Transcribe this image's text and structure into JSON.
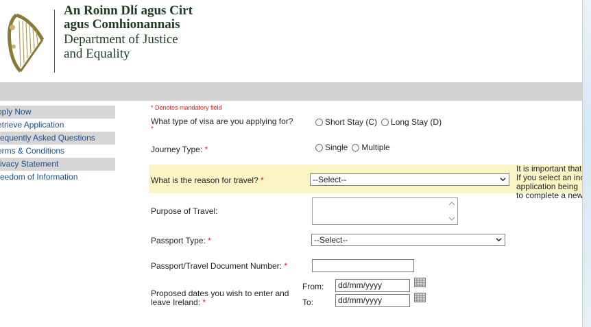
{
  "header": {
    "dept_irish_line1": "An Roinn Dlí agus Cirt",
    "dept_irish_line2": "agus Comhionannais",
    "dept_english_line1": "Department of Justice",
    "dept_english_line2": "and Equality"
  },
  "sidebar": {
    "items": [
      {
        "label": "pply Now"
      },
      {
        "label": "etrieve Application"
      },
      {
        "label": "requently Asked Questions"
      },
      {
        "label": "erms & Conditions"
      },
      {
        "label": "rivacy Statement"
      },
      {
        "label": "reedom of Information"
      }
    ]
  },
  "form": {
    "mandatory_note": "* Denotes mandatory field",
    "visa_type": {
      "label": "What type of visa are you applying for?",
      "options": [
        "Short Stay (C)",
        "Long Stay (D)"
      ]
    },
    "journey_type": {
      "label": "Journey Type:",
      "options": [
        "Single",
        "Multiple"
      ]
    },
    "reason": {
      "label": "What is the reason for travel?",
      "value": "--Select--"
    },
    "purpose": {
      "label": "Purpose of Travel:"
    },
    "passport_type": {
      "label": "Passport Type:",
      "value": "--Select--"
    },
    "passport_number": {
      "label": "Passport/Travel Document Number:"
    },
    "dates": {
      "label_line1": "Proposed dates you wish to enter and",
      "label_line2": "leave Ireland:",
      "from_label": "From:",
      "to_label": "To:",
      "from_placeholder": "dd/mm/yyyy",
      "to_placeholder": "dd/mm/yyyy"
    },
    "note_lines": [
      "It is important that",
      "If you select an inc",
      "application being",
      "to complete a new"
    ],
    "required_marker": "*"
  },
  "colors": {
    "header_text": "#1f3a23",
    "link": "#1a4f8b",
    "required": "#e02020",
    "highlight": "#fbf5c6",
    "bar": "#d3d3d3"
  }
}
